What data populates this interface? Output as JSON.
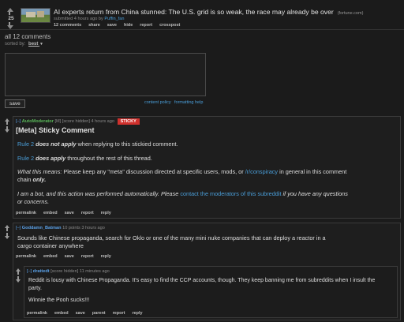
{
  "post": {
    "score": "25",
    "title": "AI experts return from China stunned: The U.S. grid is so weak, the race may already be over",
    "domain": "(fortune.com)",
    "submitted_prefix": "submitted 4 hours ago by",
    "author": "Puffin_fan",
    "links": [
      "12 comments",
      "share",
      "save",
      "hide",
      "report",
      "crosspost"
    ]
  },
  "comments_area": {
    "heading": "all 12 comments",
    "sorted_by_label": "sorted by:",
    "sort_value": "best",
    "save_label": "save",
    "content_policy": "content policy",
    "formatting_help": "formatting help"
  },
  "comments": [
    {
      "collapse": "[–]",
      "author": "AutoModerator",
      "meta": "[M] [score hidden] 4 hours ago",
      "badge": "STICKY",
      "heading": "[Meta] Sticky Comment",
      "p1_rule": "Rule 2",
      "p1_strong": "does not apply",
      "p1_rest": "when replying to this stickied comment.",
      "p2_rule": "Rule 2",
      "p2_strong": "does apply",
      "p2_rest": "throughout the rest of this thread.",
      "p3_em": "What this means:",
      "p3_text": "Please keep any \"meta\" discussion directed at specific users, mods, or",
      "p3_link": "/r/conspiracy",
      "p3_rest": "in general in this comment chain",
      "p3_only": "only.",
      "p4_a": "I am a bot, and this action was performed automatically. Please",
      "p4_link": "contact the moderators of this subreddit",
      "p4_b": "if you have any questions or concerns.",
      "links": [
        "permalink",
        "embed",
        "save",
        "report",
        "reply"
      ]
    },
    {
      "collapse": "[–]",
      "author": "Goddamn_Batman",
      "meta": "10 points 3 hours ago",
      "body": "Sounds like Chinese propaganda, search for Oklo or one of the many mini nuke companies that can deploy a reactor in a cargo container anywhere",
      "links": [
        "permalink",
        "embed",
        "save",
        "report",
        "reply"
      ]
    },
    {
      "collapse": "[–]",
      "author": "drattedt",
      "meta": "[score hidden] 11 minutes ago",
      "body1": "Reddit is lousy with Chinese Propaganda. It's easy to find the CCP accounts, though. They keep banning me from subreddits when I insult the party.",
      "body2": "Winnie the Pooh sucks!!!",
      "links": [
        "permalink",
        "embed",
        "save",
        "parent",
        "report",
        "reply"
      ]
    }
  ],
  "colors": {
    "background": "#1b1b1b",
    "link_blue": "#4a9ed9",
    "mod_green": "#5ab85a",
    "sticky_red": "#d0312d"
  }
}
